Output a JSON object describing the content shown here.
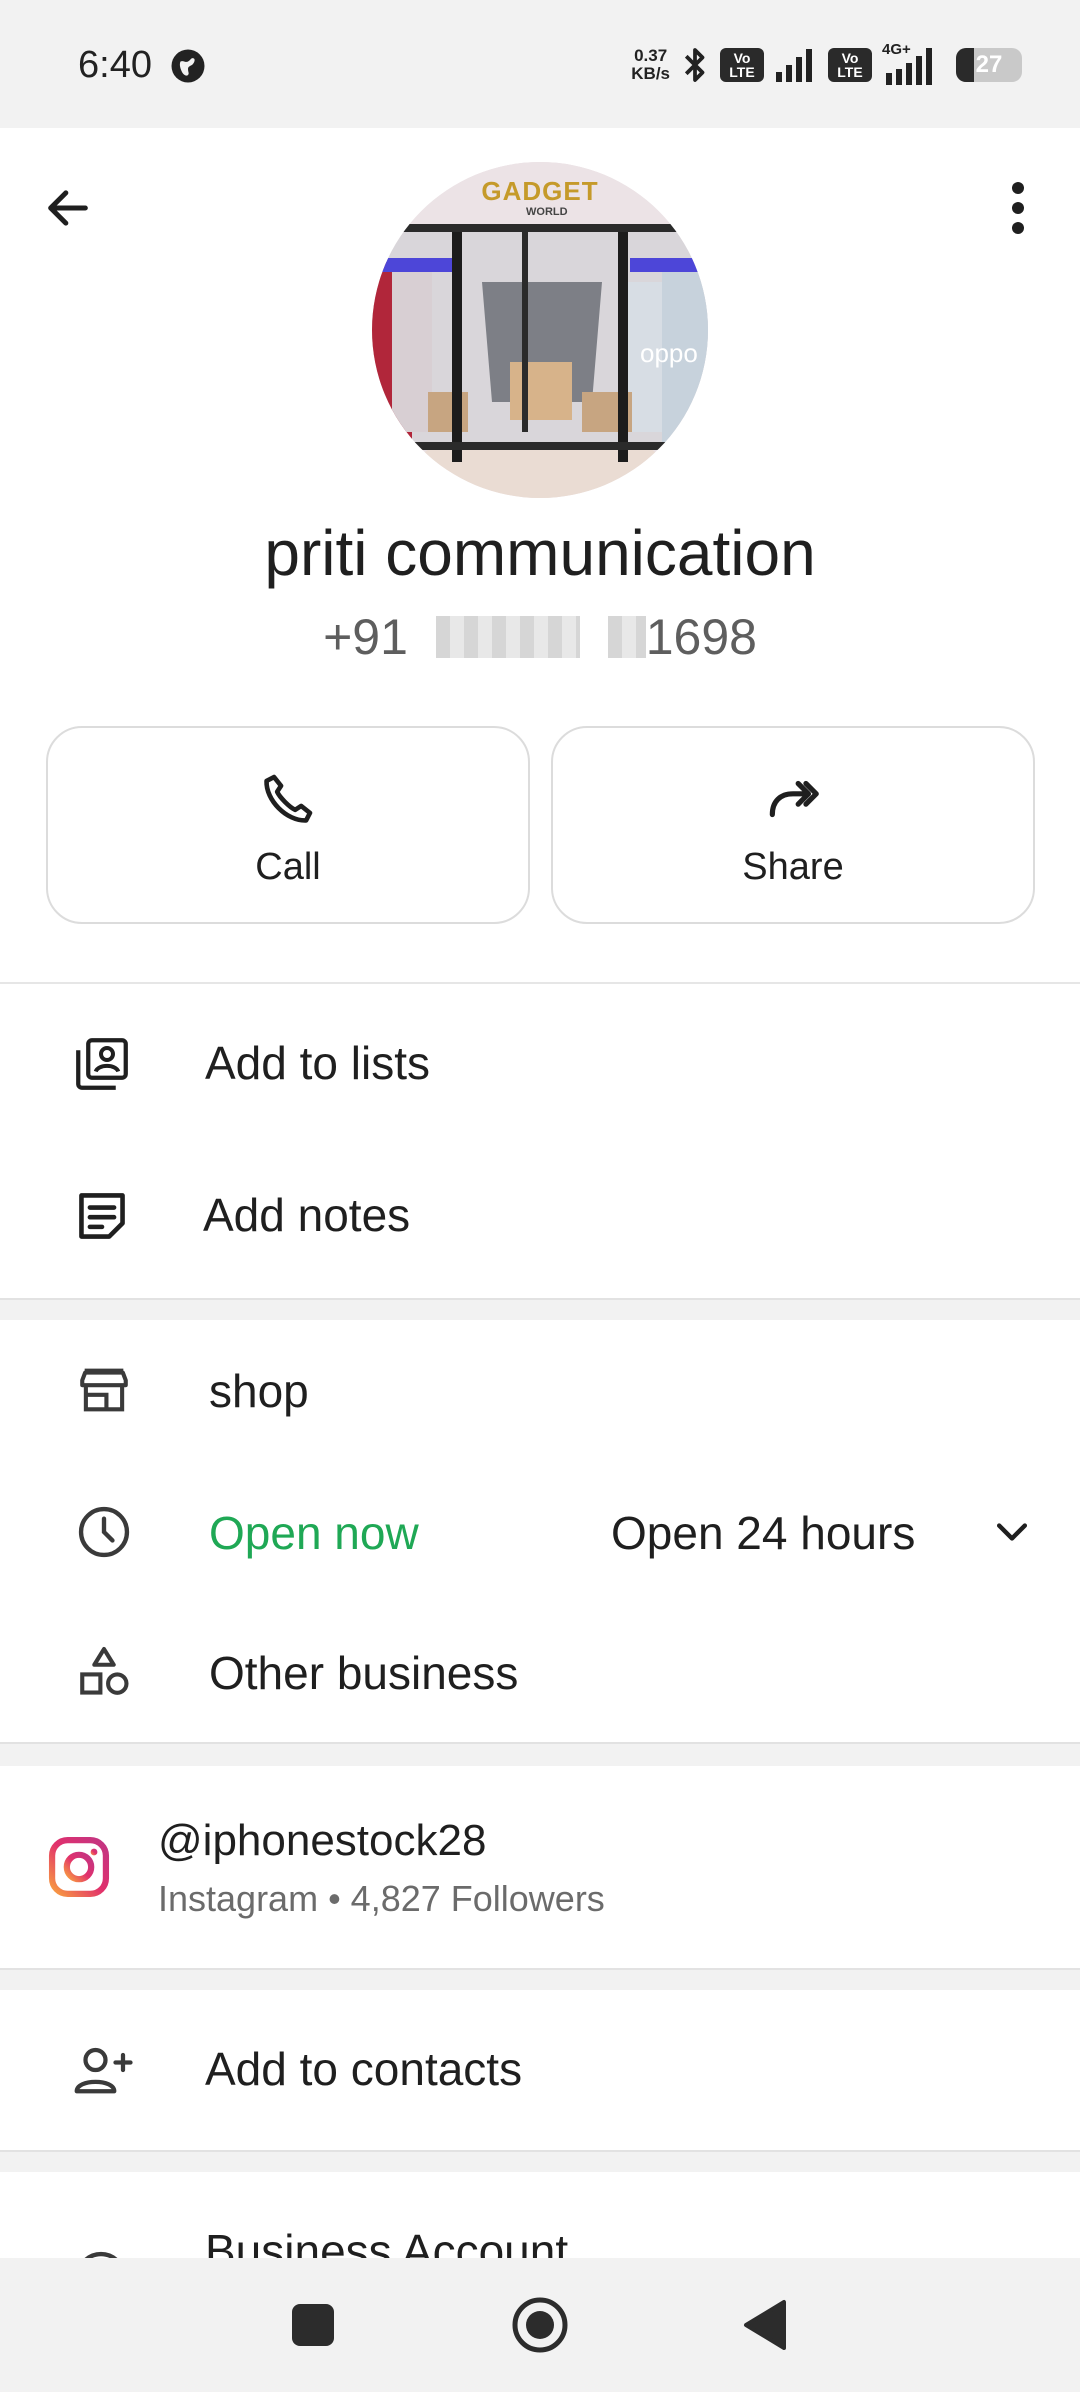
{
  "status_bar": {
    "time": "6:40",
    "net_speed_value": "0.37",
    "net_speed_unit": "KB/s",
    "volte_label": "Vo LTE",
    "network_type": "4G+",
    "battery_level": "27",
    "battery_fraction": 0.27
  },
  "header": {
    "back_icon": "arrow-left-icon",
    "menu_icon": "more-vert-icon",
    "avatar_sign_text": "GADGET",
    "avatar_sign_subtext": "WORLD",
    "avatar_brand_text": "oppo"
  },
  "contact": {
    "name": "priti communication",
    "phone_prefix": "+91",
    "phone_suffix": "1698"
  },
  "actions": {
    "call_label": "Call",
    "share_label": "Share"
  },
  "list_actions": {
    "add_to_lists_label": "Add to lists",
    "add_notes_label": "Add notes"
  },
  "business": {
    "category": "shop",
    "hours_status": "Open now",
    "hours_detail": "Open 24 hours",
    "other_label": "Other business",
    "accent_open_color": "#1fa855"
  },
  "instagram": {
    "handle": "@iphonestock28",
    "detail": "Instagram • 4,827 Followers"
  },
  "contacts": {
    "add_label": "Add to contacts"
  },
  "partial": {
    "business_account_label": "Business Account"
  }
}
